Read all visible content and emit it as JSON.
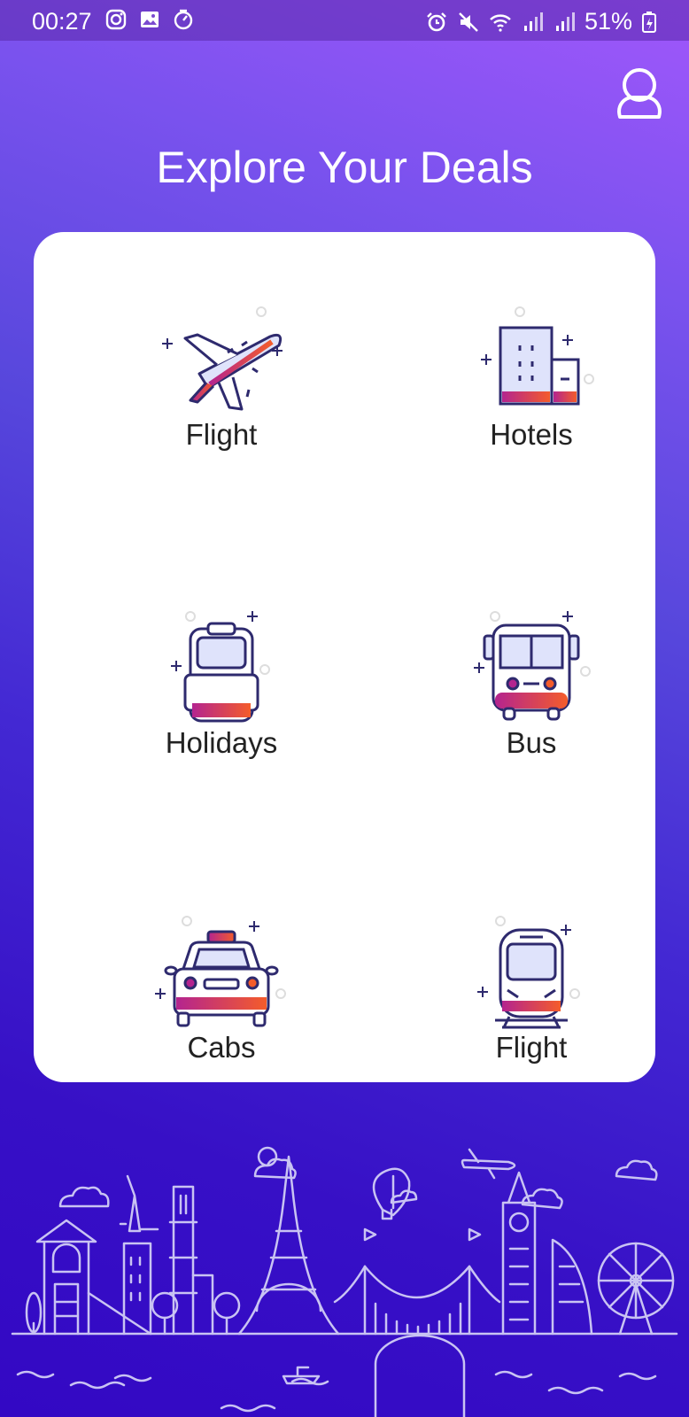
{
  "status_bar": {
    "time": "00:27",
    "battery": "51%"
  },
  "header": {
    "title": "Explore Your Deals"
  },
  "deals": [
    {
      "label": "Flight",
      "icon": "airplane-icon"
    },
    {
      "label": "Hotels",
      "icon": "hotel-icon"
    },
    {
      "label": "Holidays",
      "icon": "backpack-icon"
    },
    {
      "label": "Bus",
      "icon": "bus-icon"
    },
    {
      "label": "Cabs",
      "icon": "taxi-icon"
    },
    {
      "label": "Flight",
      "icon": "train-icon"
    }
  ],
  "colors": {
    "gradient_top": "#a057fb",
    "gradient_bottom": "#3308c4",
    "icon_outline": "#2e2a6e",
    "accent_start": "#b4248f",
    "accent_end": "#f45c2b",
    "icon_fill": "#dfe3fb"
  }
}
